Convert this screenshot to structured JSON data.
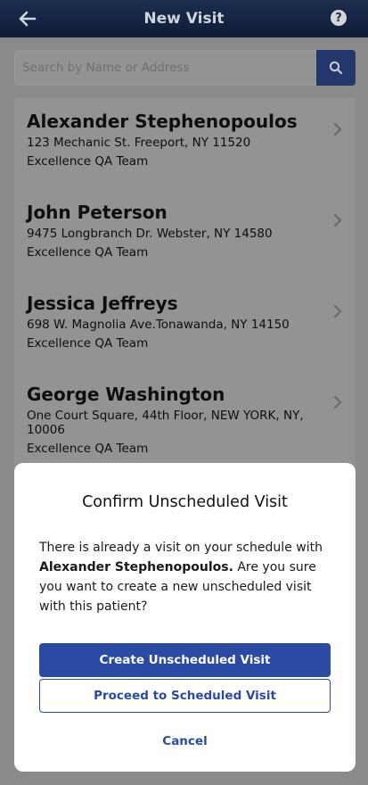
{
  "header": {
    "title": "New Visit",
    "back_icon": "arrow-left-icon",
    "help_label": "?"
  },
  "search": {
    "placeholder": "Search by Name or Address",
    "value": "",
    "icon": "search-icon"
  },
  "patients": [
    {
      "name": "Alexander Stephenopoulos",
      "address": "123 Mechanic St. Freeport, NY 11520",
      "team": "Excellence QA Team"
    },
    {
      "name": "John Peterson",
      "address": "9475 Longbranch Dr. Webster, NY 14580",
      "team": "Excellence QA Team"
    },
    {
      "name": "Jessica Jeffreys",
      "address": "698 W. Magnolia Ave.Tonawanda, NY 14150",
      "team": "Excellence QA Team"
    },
    {
      "name": "George Washington",
      "address": "One Court Square, 44th Floor, NEW YORK, NY, 10006",
      "team": "Excellence QA Team"
    }
  ],
  "modal": {
    "title": "Confirm Unscheduled Visit",
    "message_prefix": "There is already a visit on your schedule with",
    "patient_name": "Alexander Stephenopoulos.",
    "message_suffix": "Are you sure you want to create a new unscheduled visit with this patient?",
    "primary_label": "Create Unscheduled Visit",
    "secondary_label": "Proceed to Scheduled Visit",
    "cancel_label": "Cancel"
  },
  "colors": {
    "header_bg": "#0f1c38",
    "accent": "#2b4aa3",
    "overlay_gray": "#8a8a8a"
  }
}
